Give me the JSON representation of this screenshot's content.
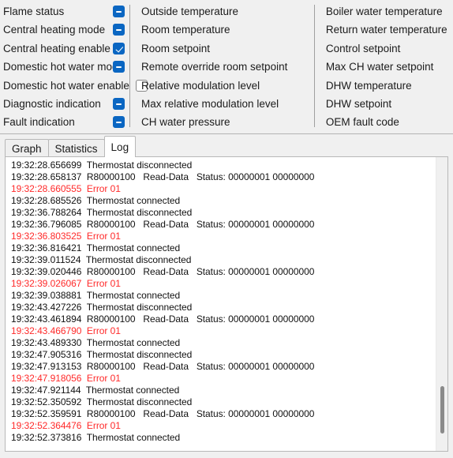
{
  "params": {
    "columns": [
      {
        "id": "flags",
        "has_checkboxes": true,
        "items": [
          {
            "label": "Flame status",
            "state": "indeterminate"
          },
          {
            "label": "Central heating mode",
            "state": "indeterminate"
          },
          {
            "label": "Central heating enable",
            "state": "checked"
          },
          {
            "label": "Domestic hot water mode",
            "state": "indeterminate"
          },
          {
            "label": "Domestic hot water enable",
            "state": "unchecked"
          },
          {
            "label": "Diagnostic indication",
            "state": "indeterminate"
          },
          {
            "label": "Fault indication",
            "state": "indeterminate"
          }
        ]
      },
      {
        "id": "room",
        "has_checkboxes": false,
        "items": [
          {
            "label": "Outside temperature"
          },
          {
            "label": "Room temperature"
          },
          {
            "label": "Room setpoint"
          },
          {
            "label": "Remote override room setpoint"
          },
          {
            "label": "Relative modulation level"
          },
          {
            "label": "Max relative modulation level"
          },
          {
            "label": "CH water pressure"
          }
        ]
      },
      {
        "id": "boiler",
        "has_checkboxes": false,
        "items": [
          {
            "label": "Boiler water temperature"
          },
          {
            "label": "Return water temperature"
          },
          {
            "label": "Control setpoint"
          },
          {
            "label": "Max CH water setpoint"
          },
          {
            "label": "DHW temperature"
          },
          {
            "label": "DHW setpoint"
          },
          {
            "label": "OEM fault code"
          }
        ]
      }
    ]
  },
  "tabs": [
    {
      "label": "Graph",
      "active": false
    },
    {
      "label": "Statistics",
      "active": false
    },
    {
      "label": "Log",
      "active": true
    }
  ],
  "log": {
    "lines": [
      {
        "ts": "19:32:28.656699",
        "msg": "Thermostat disconnected",
        "error": false
      },
      {
        "ts": "19:32:28.658137",
        "msg": "R80000100   Read-Data   Status: 00000001 00000000",
        "error": false
      },
      {
        "ts": "19:32:28.660555",
        "msg": "Error 01",
        "error": true
      },
      {
        "ts": "19:32:28.685526",
        "msg": "Thermostat connected",
        "error": false
      },
      {
        "ts": "19:32:36.788264",
        "msg": "Thermostat disconnected",
        "error": false
      },
      {
        "ts": "19:32:36.796085",
        "msg": "R80000100   Read-Data   Status: 00000001 00000000",
        "error": false
      },
      {
        "ts": "19:32:36.803525",
        "msg": "Error 01",
        "error": true
      },
      {
        "ts": "19:32:36.816421",
        "msg": "Thermostat connected",
        "error": false
      },
      {
        "ts": "19:32:39.011524",
        "msg": "Thermostat disconnected",
        "error": false
      },
      {
        "ts": "19:32:39.020446",
        "msg": "R80000100   Read-Data   Status: 00000001 00000000",
        "error": false
      },
      {
        "ts": "19:32:39.026067",
        "msg": "Error 01",
        "error": true
      },
      {
        "ts": "19:32:39.038881",
        "msg": "Thermostat connected",
        "error": false
      },
      {
        "ts": "19:32:43.427226",
        "msg": "Thermostat disconnected",
        "error": false
      },
      {
        "ts": "19:32:43.461894",
        "msg": "R80000100   Read-Data   Status: 00000001 00000000",
        "error": false
      },
      {
        "ts": "19:32:43.466790",
        "msg": "Error 01",
        "error": true
      },
      {
        "ts": "19:32:43.489330",
        "msg": "Thermostat connected",
        "error": false
      },
      {
        "ts": "19:32:47.905316",
        "msg": "Thermostat disconnected",
        "error": false
      },
      {
        "ts": "19:32:47.913153",
        "msg": "R80000100   Read-Data   Status: 00000001 00000000",
        "error": false
      },
      {
        "ts": "19:32:47.918056",
        "msg": "Error 01",
        "error": true
      },
      {
        "ts": "19:32:47.921144",
        "msg": "Thermostat connected",
        "error": false
      },
      {
        "ts": "19:32:52.350592",
        "msg": "Thermostat disconnected",
        "error": false
      },
      {
        "ts": "19:32:52.359591",
        "msg": "R80000100   Read-Data   Status: 00000001 00000000",
        "error": false
      },
      {
        "ts": "19:32:52.364476",
        "msg": "Error 01",
        "error": true
      },
      {
        "ts": "19:32:52.373816",
        "msg": "Thermostat connected",
        "error": false
      }
    ],
    "scrollbar": {
      "thumb_top_pct": 78,
      "thumb_height_pct": 16
    }
  },
  "colors": {
    "checkbox_accent": "#0a66c2",
    "error_text": "#ff2a2a",
    "panel_bg": "#f0f0f0",
    "log_bg": "#ffffff"
  }
}
